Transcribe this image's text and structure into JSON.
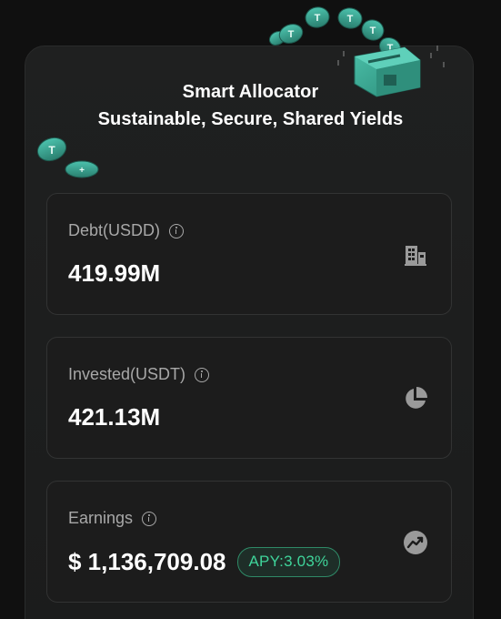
{
  "header": {
    "title_line1": "Smart Allocator",
    "title_line2": "Sustainable, Secure, Shared Yields"
  },
  "cards": [
    {
      "label": "Debt(USDD)",
      "value": "419.99M",
      "icon": "building-icon"
    },
    {
      "label": "Invested(USDT)",
      "value": "421.13M",
      "icon": "pie-chart-icon"
    },
    {
      "label": "Earnings",
      "value": "$ 1,136,709.08",
      "badge": "APY:3.03%",
      "icon": "trending-up-icon"
    }
  ],
  "colors": {
    "background": "#101010",
    "panel": "#1e1f1f",
    "card_border": "#323333",
    "accent_green": "#3fd49a",
    "coin_teal": "#3aa491"
  }
}
